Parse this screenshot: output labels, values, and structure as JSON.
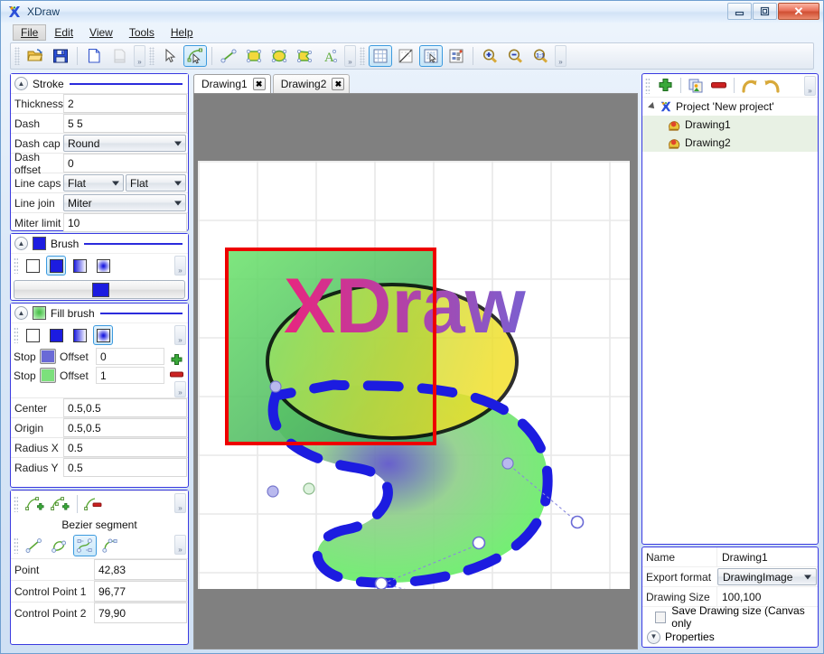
{
  "window": {
    "title": "XDraw",
    "app_icon": "xdraw-logo-icon",
    "minimize_label": "–",
    "maximize_label": "❐",
    "close_label": "✕"
  },
  "menu": {
    "items": [
      {
        "label": "File",
        "active": true
      },
      {
        "label": "Edit",
        "active": false
      },
      {
        "label": "View",
        "active": false
      },
      {
        "label": "Tools",
        "active": false
      },
      {
        "label": "Help",
        "active": false
      }
    ]
  },
  "toolbar": {
    "groups": [
      {
        "buttons": [
          {
            "name": "open-icon",
            "title": "Open",
            "selected": false,
            "disabled": false
          },
          {
            "name": "save-icon",
            "title": "Save",
            "selected": false,
            "disabled": false
          },
          {
            "name": "new-page-icon",
            "title": "New",
            "selected": false,
            "disabled": false
          },
          {
            "name": "export-icon",
            "title": "Export",
            "selected": false,
            "disabled": true
          }
        ]
      },
      {
        "buttons": [
          {
            "name": "pointer-select-icon",
            "title": "Select",
            "selected": false,
            "disabled": false
          },
          {
            "name": "node-edit-icon",
            "title": "Edit nodes",
            "selected": true,
            "disabled": false
          },
          {
            "name": "line-tool-icon",
            "title": "Line",
            "selected": false,
            "disabled": false
          },
          {
            "name": "rectangle-tool-icon",
            "title": "Rectangle",
            "selected": false,
            "disabled": false
          },
          {
            "name": "ellipse-tool-icon",
            "title": "Ellipse",
            "selected": false,
            "disabled": false
          },
          {
            "name": "polygon-tool-icon",
            "title": "Polygon",
            "selected": false,
            "disabled": false
          },
          {
            "name": "text-tool-icon",
            "title": "Text",
            "selected": false,
            "disabled": false
          }
        ]
      },
      {
        "buttons": [
          {
            "name": "show-grid-icon",
            "title": "Show grid",
            "selected": true,
            "disabled": false
          },
          {
            "name": "snap-diagonal-icon",
            "title": "Snap",
            "selected": false,
            "disabled": false
          },
          {
            "name": "select-mode-icon",
            "title": "Select mode",
            "selected": true,
            "disabled": false
          },
          {
            "name": "layers-icon",
            "title": "Layers",
            "selected": false,
            "disabled": false
          },
          {
            "name": "zoom-in-icon",
            "title": "Zoom in",
            "selected": false,
            "disabled": false
          },
          {
            "name": "zoom-out-icon",
            "title": "Zoom out",
            "selected": false,
            "disabled": false
          },
          {
            "name": "zoom-reset-icon",
            "title": "Zoom 1:1",
            "selected": false,
            "disabled": false
          }
        ]
      }
    ],
    "overflow_label": "»"
  },
  "stroke_panel": {
    "title": "Stroke",
    "collapse_icon": "chevron-up-icon",
    "fields": [
      {
        "label": "Thickness",
        "value": "2",
        "type": "text"
      },
      {
        "label": "Dash",
        "value": "5 5",
        "type": "text"
      },
      {
        "label": "Dash cap",
        "value": "Round",
        "type": "combo"
      },
      {
        "label": "Dash offset",
        "value": "0",
        "type": "text"
      },
      {
        "label": "Line caps",
        "value": "Flat",
        "value2": "Flat",
        "type": "combo2"
      },
      {
        "label": "Line join",
        "value": "Miter",
        "type": "combo"
      },
      {
        "label": "Miter limit",
        "value": "10",
        "type": "text"
      }
    ]
  },
  "brush_panel": {
    "title": "Brush",
    "collapse_icon": "chevron-up-icon",
    "current_color": "#1c1ce0",
    "styles": [
      {
        "name": "brush-style-none",
        "label": "None",
        "selected": false
      },
      {
        "name": "brush-style-solid",
        "label": "Solid",
        "selected": true
      },
      {
        "name": "brush-style-linear-gradient",
        "label": "Linear gradient",
        "selected": false
      },
      {
        "name": "brush-style-radial-gradient",
        "label": "Radial gradient",
        "selected": false
      }
    ],
    "overflow_label": "»"
  },
  "fill_panel": {
    "title": "Fill brush",
    "collapse_icon": "chevron-up-icon",
    "styles": [
      {
        "name": "fill-style-none",
        "label": "None",
        "selected": false
      },
      {
        "name": "fill-style-solid",
        "label": "Solid",
        "selected": false
      },
      {
        "name": "fill-style-linear-gradient",
        "label": "Linear gradient",
        "selected": false
      },
      {
        "name": "fill-style-radial-gradient",
        "label": "Radial gradient",
        "selected": true
      }
    ],
    "stops": [
      {
        "label": "Stop",
        "color": "#6a6ad6",
        "offset_label": "Offset",
        "offset_value": "0"
      },
      {
        "label": "Stop",
        "color": "#7ce07c",
        "offset_label": "Offset",
        "offset_value": "1"
      }
    ],
    "add_stop_icon": "plus-icon",
    "remove_stop_icon": "minus-icon",
    "geometry": [
      {
        "label": "Center",
        "value": "0.5,0.5"
      },
      {
        "label": "Origin",
        "value": "0.5,0.5"
      },
      {
        "label": "Radius X",
        "value": "0.5"
      },
      {
        "label": "Radius Y",
        "value": "0.5"
      }
    ]
  },
  "segment_panel": {
    "title": "Bezier segment",
    "node_tools": [
      {
        "name": "add-node-icon",
        "label": "Add node",
        "selected": false
      },
      {
        "name": "insert-node-icon",
        "label": "Insert node",
        "selected": false
      },
      {
        "name": "delete-node-icon",
        "label": "Delete node",
        "selected": false
      }
    ],
    "segment_types": [
      {
        "name": "line-segment-icon",
        "label": "Line segment",
        "selected": false
      },
      {
        "name": "arc-segment-icon",
        "label": "Arc segment",
        "selected": false
      },
      {
        "name": "bezier-segment-icon",
        "label": "Bezier segment",
        "selected": true
      },
      {
        "name": "quadratic-segment-icon",
        "label": "Quadratic segment",
        "selected": false
      }
    ],
    "fields": [
      {
        "label": "Point",
        "value": "42,83"
      },
      {
        "label": "Control Point 1",
        "value": "96,77"
      },
      {
        "label": "Control Point 2",
        "value": "79,90"
      }
    ]
  },
  "tabs": [
    {
      "label": "Drawing1",
      "active": true,
      "close_label": "✖"
    },
    {
      "label": "Drawing2",
      "active": false,
      "close_label": "✖"
    }
  ],
  "canvas": {
    "background_color": "#808080",
    "page_color": "#ffffff",
    "grid_color": "#e6e6e6",
    "grid_spacing": 65,
    "text_label": "XDraw",
    "selection_color": "#ee0000",
    "stroke_color": "#1c1ce0",
    "ellipse_outline_color": "#000000"
  },
  "project_panel": {
    "toolbar": [
      {
        "name": "add-drawing-icon",
        "label": "Add"
      },
      {
        "name": "copy-drawing-icon",
        "label": "Copy"
      },
      {
        "name": "delete-drawing-icon",
        "label": "Delete"
      },
      {
        "name": "undo-icon",
        "label": "Undo"
      },
      {
        "name": "redo-icon",
        "label": "Redo"
      }
    ],
    "overflow_label": "»",
    "root": {
      "label": "Project 'New project'",
      "icon": "xdraw-logo-icon"
    },
    "children": [
      {
        "label": "Drawing1",
        "icon": "drawing-icon",
        "selected": true
      },
      {
        "label": "Drawing2",
        "icon": "drawing-icon",
        "selected": true
      }
    ]
  },
  "properties_panel": {
    "rows": [
      {
        "label": "Name",
        "value": "Drawing1",
        "type": "text"
      },
      {
        "label": "Export format",
        "value": "DrawingImage",
        "type": "combo"
      },
      {
        "label": "Drawing Size",
        "value": "100,100",
        "type": "text"
      }
    ],
    "checkbox": {
      "label": "Save Drawing size (Canvas only",
      "checked": false
    },
    "footer": {
      "label": "Properties",
      "icon": "chevron-down-icon"
    }
  }
}
